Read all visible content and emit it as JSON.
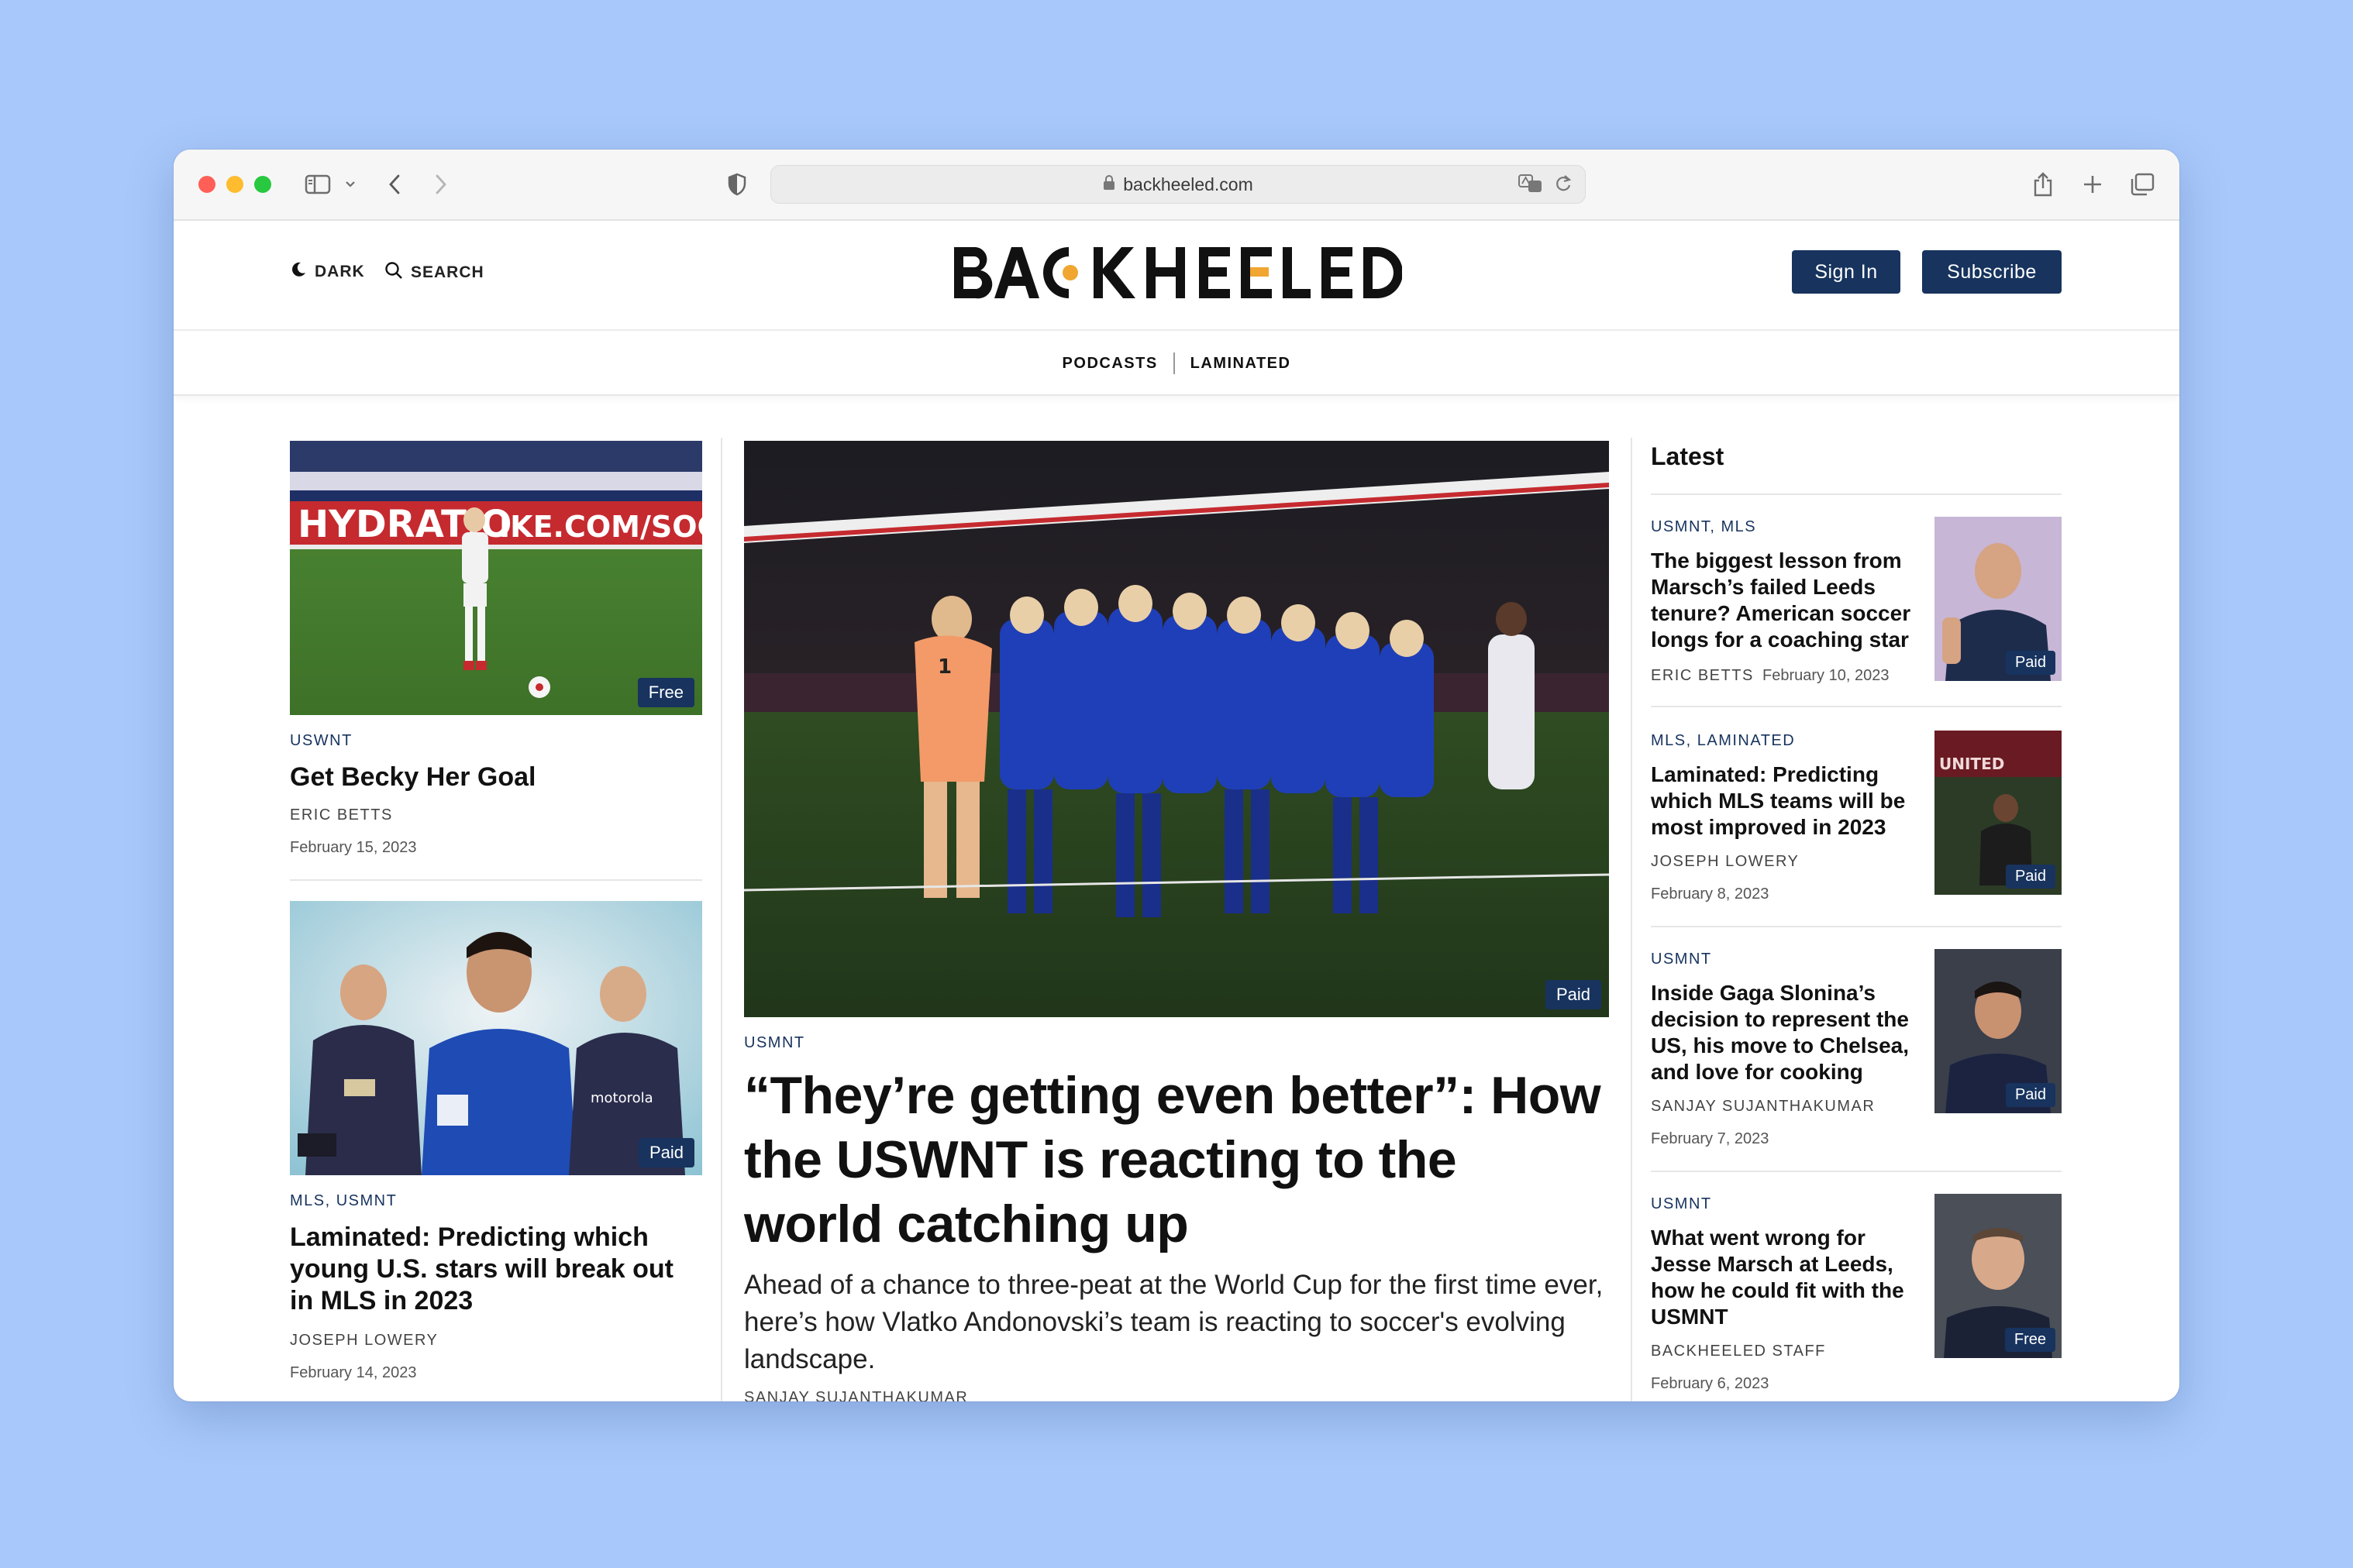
{
  "browser": {
    "url": "backheeled.com"
  },
  "header": {
    "dark_label": "DARK",
    "search_label": "SEARCH",
    "logo_text": "BACKHEELED",
    "sign_in_label": "Sign In",
    "subscribe_label": "Subscribe"
  },
  "subnav": [
    "PODCASTS",
    "LAMINATED"
  ],
  "left_column": [
    {
      "badge": "Free",
      "tag": "USWNT",
      "title": "Get Becky Her Goal",
      "author": "ERIC BETTS",
      "date": "February 15, 2023"
    },
    {
      "badge": "Paid",
      "tag": "MLS, USMNT",
      "title": "Laminated: Predicting which young U.S. stars will break out in MLS in 2023",
      "author": "JOSEPH LOWERY",
      "date": "February 14, 2023"
    }
  ],
  "feature": {
    "badge": "Paid",
    "tag": "USMNT",
    "title": "“They’re getting even better”: How the USWNT is reacting to the world catching up",
    "dek": "Ahead of a chance to three-peat at the World Cup for the first time ever, here’s how Vlatko Andonovski’s team is reacting to soccer's evolving landscape.",
    "author": "SANJAY SUJANTHAKUMAR"
  },
  "latest": {
    "heading": "Latest",
    "items": [
      {
        "tag": "USMNT, MLS",
        "title": "The biggest lesson from Marsch’s failed Leeds tenure? American soccer longs for a coaching star",
        "author": "ERIC BETTS",
        "date": "February 10, 2023",
        "badge": "Paid"
      },
      {
        "tag": "MLS, LAMINATED",
        "title": "Laminated: Predicting which MLS teams will be most improved in 2023",
        "author": "JOSEPH LOWERY",
        "date": "February 8, 2023",
        "badge": "Paid"
      },
      {
        "tag": "USMNT",
        "title": "Inside Gaga Slonina’s decision to represent the US, his move to Chelsea, and love for cooking",
        "author": "SANJAY SUJANTHAKUMAR",
        "date": "February 7, 2023",
        "badge": "Paid"
      },
      {
        "tag": "USMNT",
        "title": "What went wrong for Jesse Marsch at Leeds, how he could fit with the USMNT",
        "author": "BACKHEELED STAFF",
        "date": "February 6, 2023",
        "badge": "Free"
      }
    ]
  }
}
